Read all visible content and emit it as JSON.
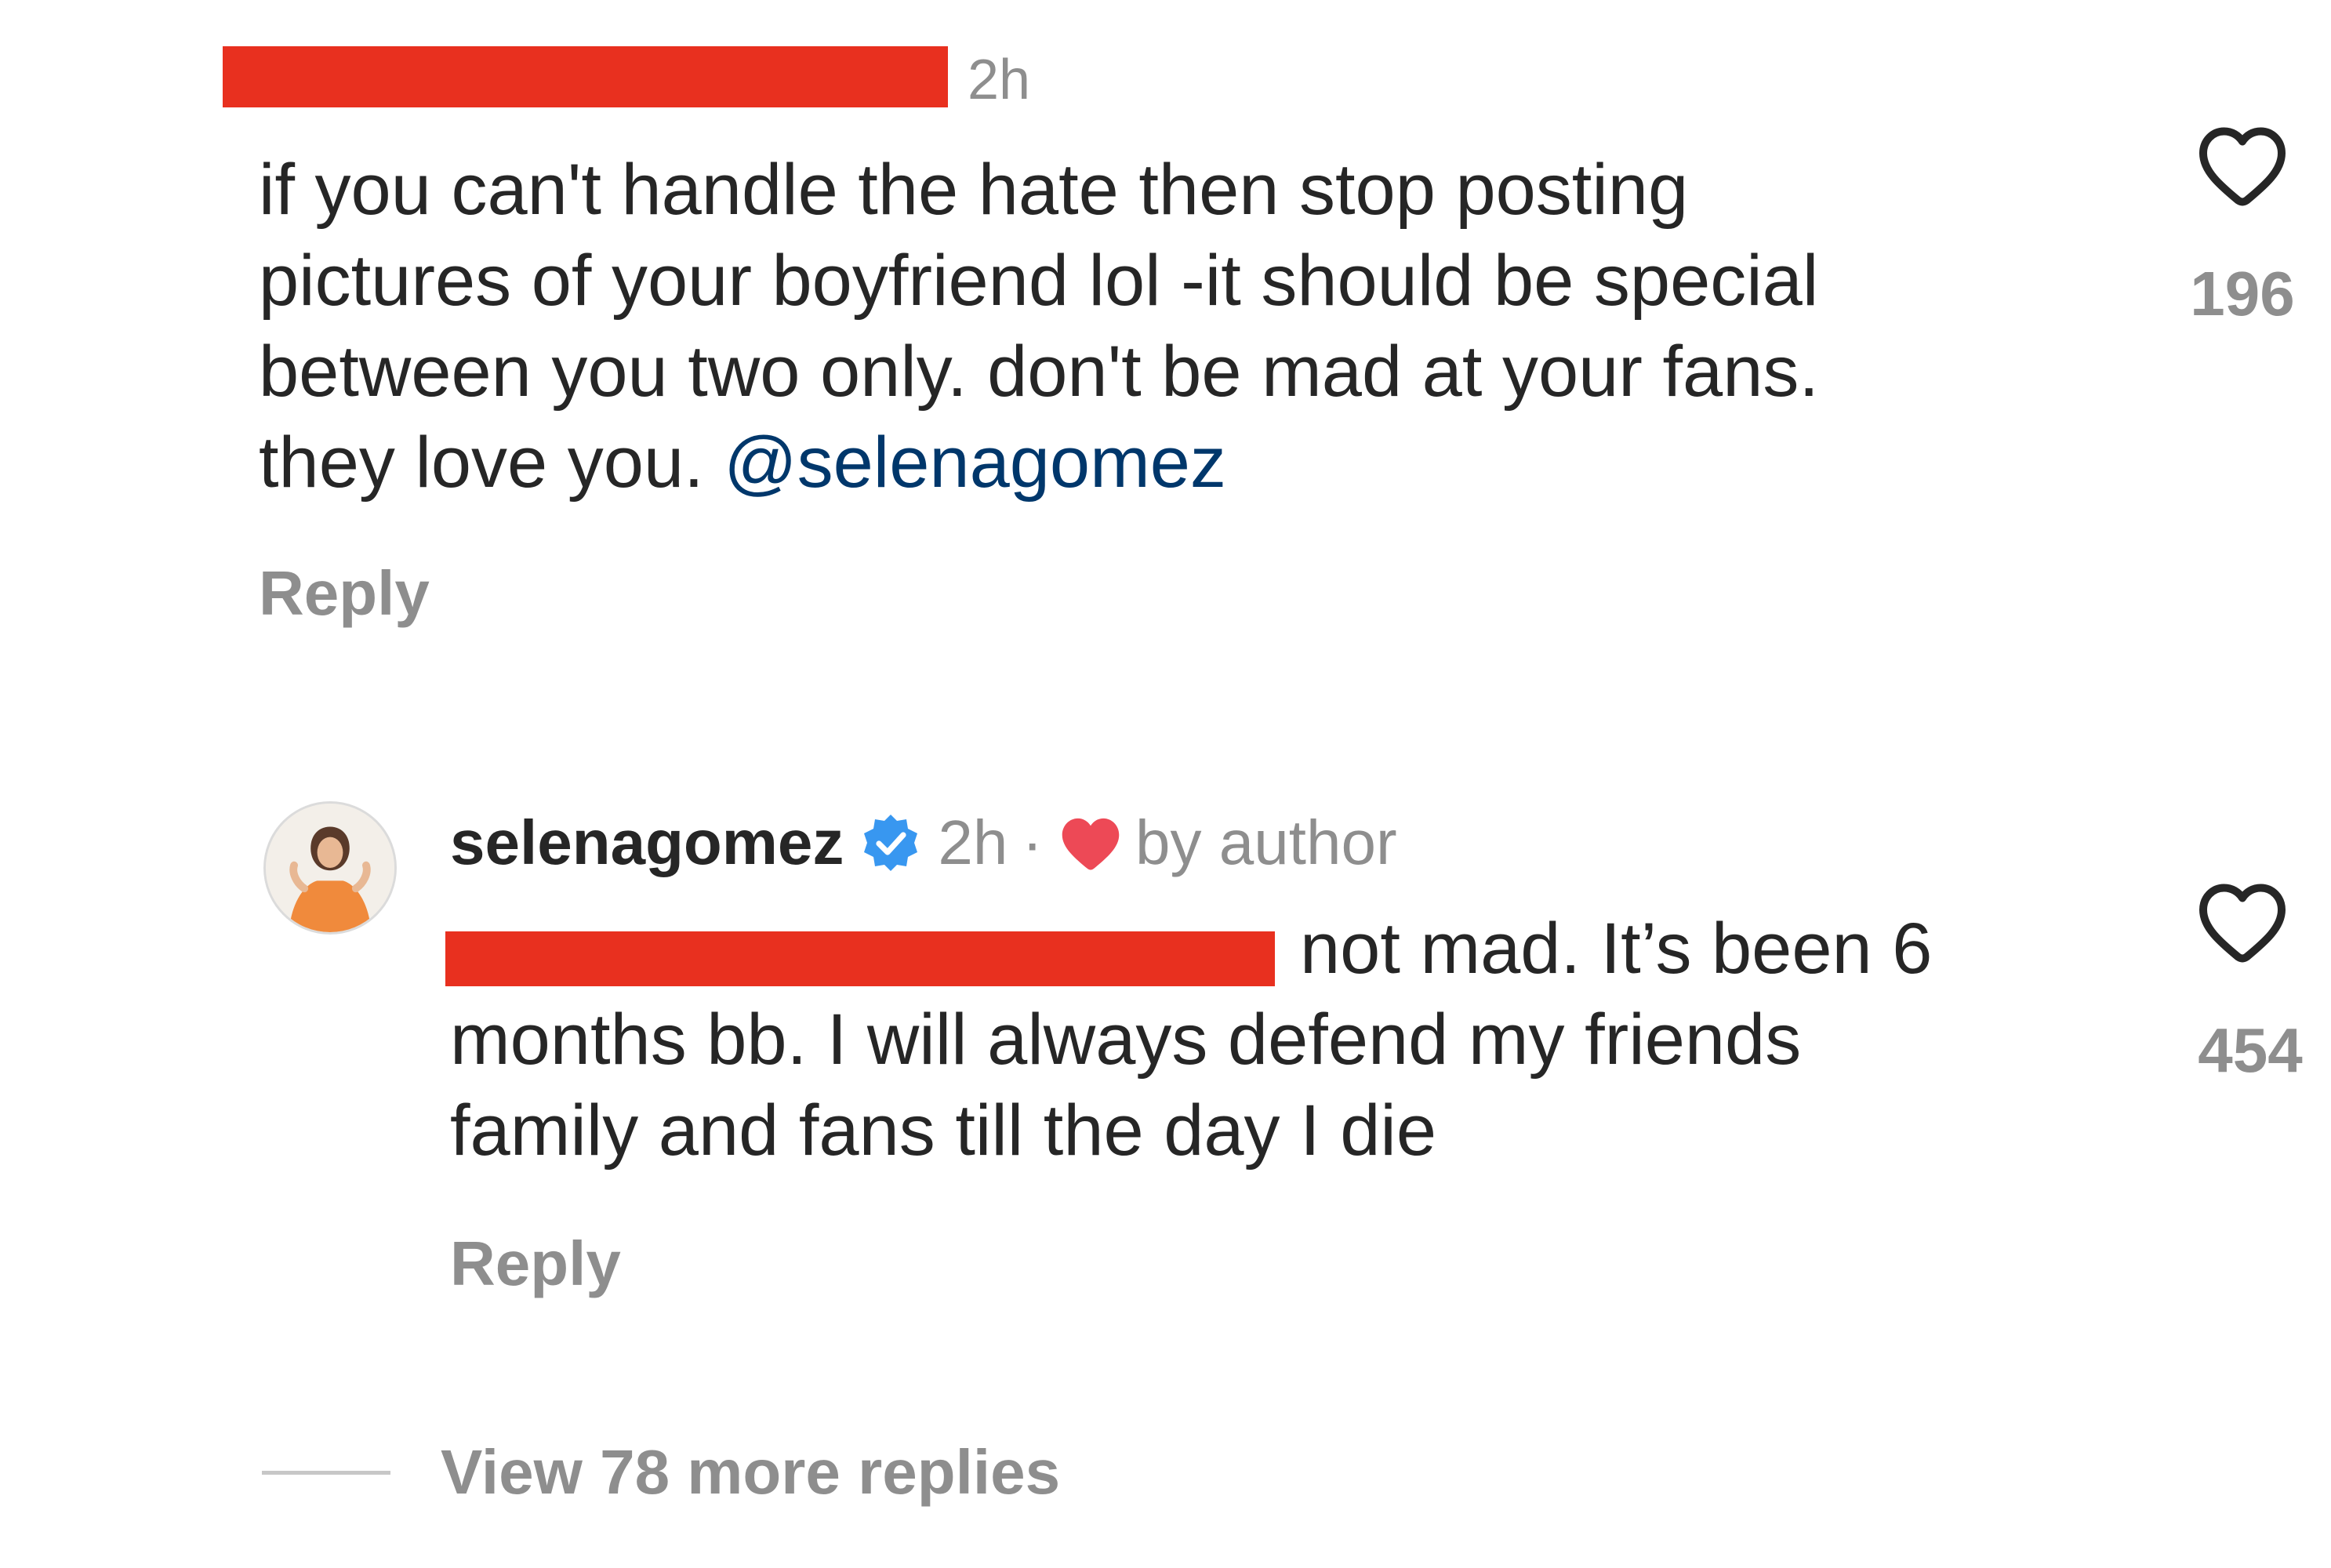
{
  "comments": [
    {
      "username_redacted": true,
      "time": "2h",
      "text": "if you can't handle the hate then stop posting\npictures of your boyfriend lol -it should be special\nbetween you two only. don't be mad at your fans.\nthey love you. ",
      "mention": "@selenagomez",
      "reply_label": "Reply",
      "like_icon": "heart-outline-icon",
      "likes": "196"
    },
    {
      "username": "selenagomez",
      "verified_icon": "verified-badge-icon",
      "time": "2h",
      "separator": "·",
      "author_like_icon": "red-heart-icon",
      "by_author": "by author",
      "text_lines": [
        "not mad. It’s been 6",
        "months bb. I will always defend my friends",
        "family and fans till the day I die"
      ],
      "reply_label": "Reply",
      "like_icon": "heart-outline-icon",
      "likes": "454"
    }
  ],
  "view_more_replies": "View 78 more replies",
  "colors": {
    "text": "#262626",
    "muted": "#8e8e8e",
    "mention": "#00376b",
    "redaction": "#e8301f",
    "verified": "#3897f0",
    "like_red": "#ed4956"
  }
}
